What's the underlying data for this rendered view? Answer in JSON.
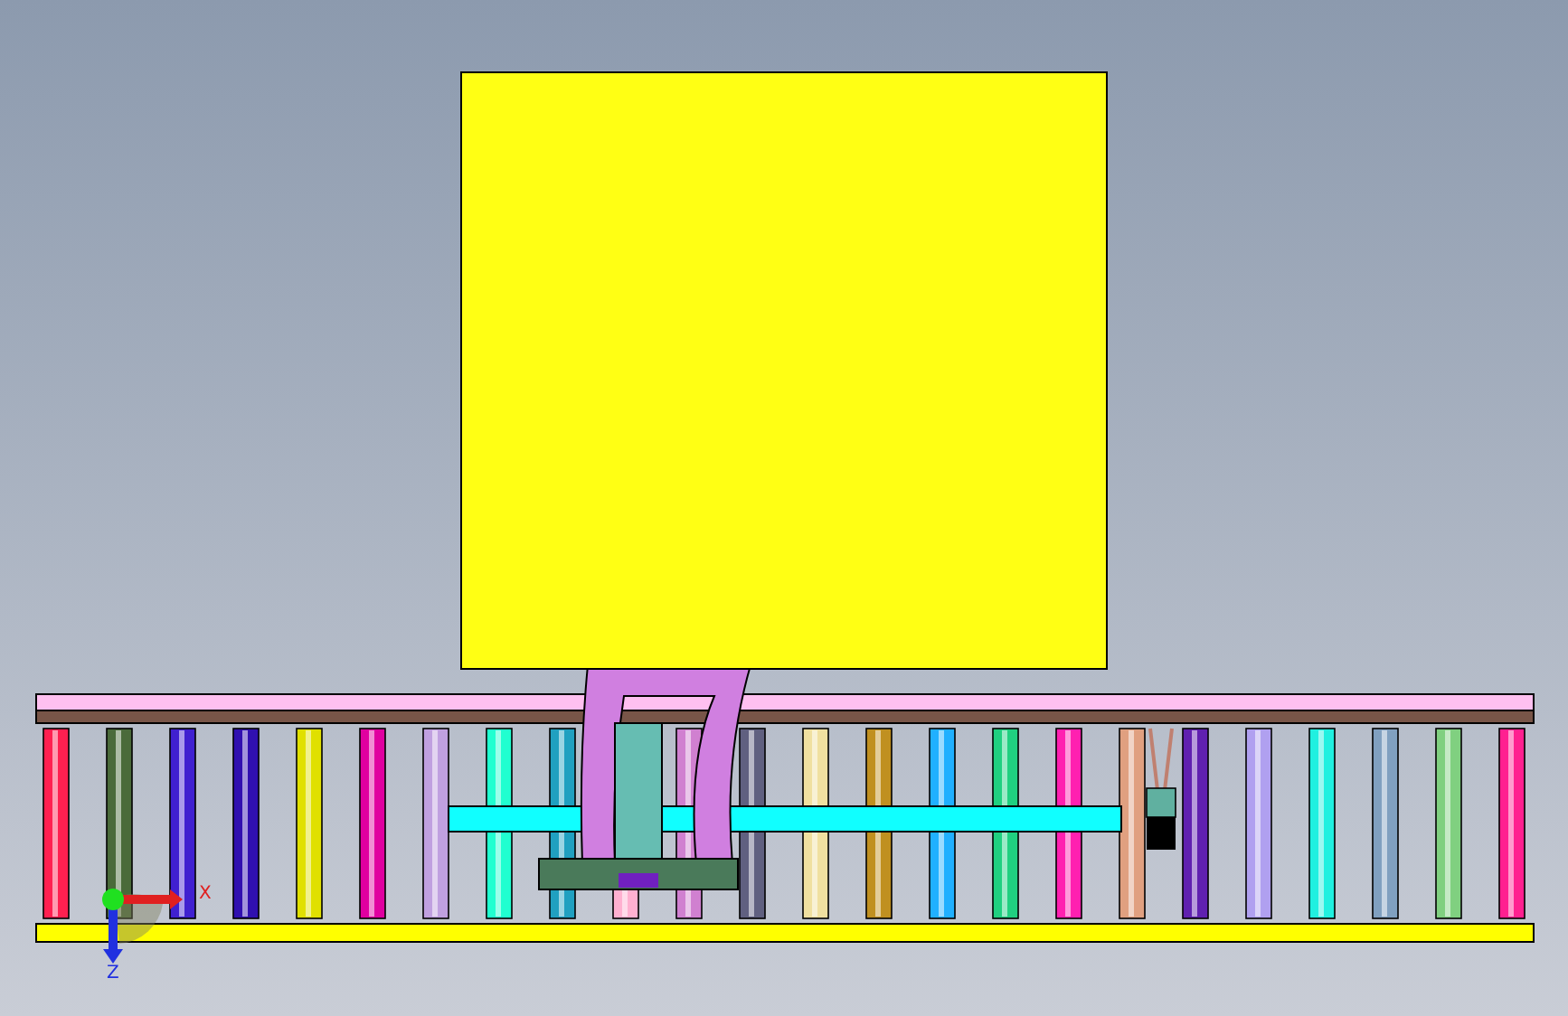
{
  "viewport": {
    "axes": [
      {
        "kind": "x",
        "label": "X"
      },
      {
        "kind": "z",
        "label": "Z"
      }
    ],
    "rollers": [
      {
        "color": "#ff2050"
      },
      {
        "color": "#4a6a3a"
      },
      {
        "color": "#4020d0"
      },
      {
        "color": "#3010b0"
      },
      {
        "color": "#e0e000"
      },
      {
        "color": "#e000a0"
      },
      {
        "color": "#c0a0e0"
      },
      {
        "color": "#20ffd0"
      },
      {
        "color": "#20a0c0"
      },
      {
        "color": "#ffb0d0"
      },
      {
        "color": "#d080d0"
      },
      {
        "color": "#606080"
      },
      {
        "color": "#f0e0a0"
      },
      {
        "color": "#c09020"
      },
      {
        "color": "#20b0ff"
      },
      {
        "color": "#20d080"
      },
      {
        "color": "#ff20b0"
      },
      {
        "color": "#e0a080"
      },
      {
        "color": "#6020b0"
      },
      {
        "color": "#b0a0f0"
      },
      {
        "color": "#20f0e0"
      },
      {
        "color": "#80a0c0"
      },
      {
        "color": "#80d080"
      },
      {
        "color": "#ff2090"
      }
    ]
  }
}
